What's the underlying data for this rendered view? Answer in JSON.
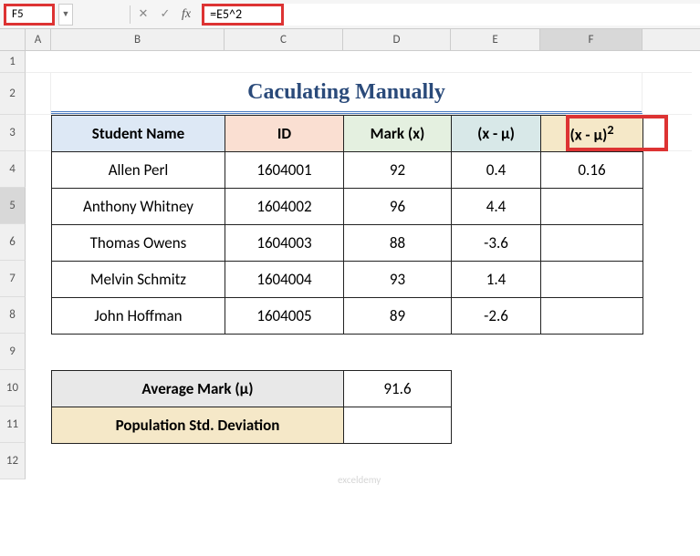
{
  "namebox": "F5",
  "formula": "=E5^2",
  "columns": [
    "A",
    "B",
    "C",
    "D",
    "E",
    "F"
  ],
  "rows": [
    "1",
    "2",
    "3",
    "4",
    "5",
    "6",
    "7",
    "8",
    "9",
    "10",
    "11",
    "12"
  ],
  "title": "Caculating Manually",
  "headers": {
    "name": "Student Name",
    "id": "ID",
    "mark": "Mark (x)",
    "diff": "(x - μ)",
    "sq_base": "(x - μ)",
    "sq_sup": "2"
  },
  "students": [
    {
      "name": "Allen Perl",
      "id": "1604001",
      "mark": "92",
      "diff": "0.4",
      "sq": "0.16"
    },
    {
      "name": "Anthony Whitney",
      "id": "1604002",
      "mark": "96",
      "diff": "4.4",
      "sq": ""
    },
    {
      "name": "Thomas Owens",
      "id": "1604003",
      "mark": "88",
      "diff": "-3.6",
      "sq": ""
    },
    {
      "name": "Melvin Schmitz",
      "id": "1604004",
      "mark": "93",
      "diff": "1.4",
      "sq": ""
    },
    {
      "name": "John Hoffman",
      "id": "1604005",
      "mark": "89",
      "diff": "-2.6",
      "sq": ""
    }
  ],
  "summary": {
    "avg_label": "Average Mark (μ)",
    "avg_val": "91.6",
    "std_label": "Population Std. Deviation",
    "std_val": ""
  },
  "watermark": "exceldemy"
}
